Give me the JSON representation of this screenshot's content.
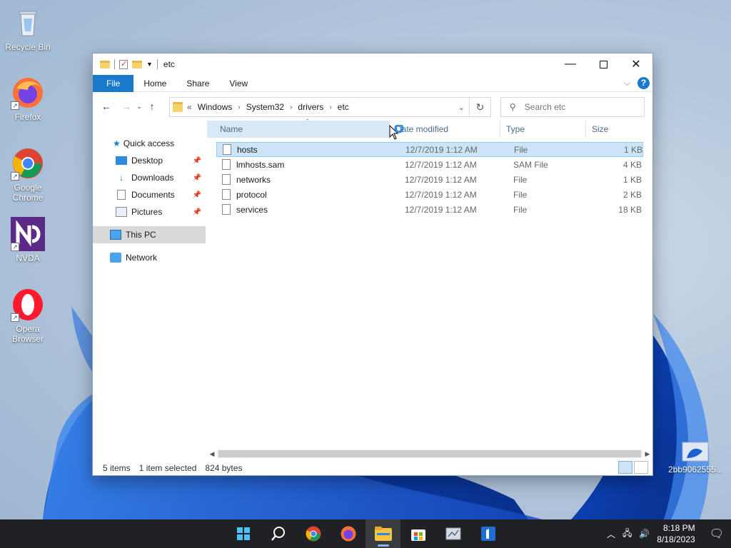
{
  "desktop": {
    "icons": [
      {
        "label": "Recycle Bin"
      },
      {
        "label": "Firefox"
      },
      {
        "label": "Google Chrome"
      },
      {
        "label": "NVDA"
      },
      {
        "label": "Opera Browser"
      },
      {
        "label": "2bb9062555..."
      }
    ]
  },
  "window": {
    "title": "etc",
    "ribbon_tabs": [
      "File",
      "Home",
      "Share",
      "View"
    ],
    "help_label": "?",
    "breadcrumb_prefix": "«",
    "breadcrumb": [
      "Windows",
      "System32",
      "drivers",
      "etc"
    ],
    "search_placeholder": "Search etc",
    "nav_pane": [
      {
        "label": "Quick access"
      },
      {
        "label": "Desktop",
        "pinned": true
      },
      {
        "label": "Downloads",
        "pinned": true
      },
      {
        "label": "Documents",
        "pinned": true
      },
      {
        "label": "Pictures",
        "pinned": true
      },
      {
        "label": "This PC",
        "selected": true
      },
      {
        "label": "Network"
      }
    ],
    "columns": [
      "Name",
      "Date modified",
      "Type",
      "Size"
    ],
    "files": [
      {
        "name": "hosts",
        "date": "12/7/2019 1:12 AM",
        "type": "File",
        "size": "1 KB",
        "selected": true
      },
      {
        "name": "lmhosts.sam",
        "date": "12/7/2019 1:12 AM",
        "type": "SAM File",
        "size": "4 KB"
      },
      {
        "name": "networks",
        "date": "12/7/2019 1:12 AM",
        "type": "File",
        "size": "1 KB"
      },
      {
        "name": "protocol",
        "date": "12/7/2019 1:12 AM",
        "type": "File",
        "size": "2 KB"
      },
      {
        "name": "services",
        "date": "12/7/2019 1:12 AM",
        "type": "File",
        "size": "18 KB"
      }
    ],
    "status": {
      "items": "5 items",
      "selected": "1 item selected",
      "bytes": "824 bytes"
    }
  },
  "taskbar": {
    "time": "8:18 PM",
    "date": "8/18/2023"
  },
  "colors": {
    "accent": "#1979ca",
    "selection": "#cce4f7",
    "taskbar": "#202124"
  }
}
